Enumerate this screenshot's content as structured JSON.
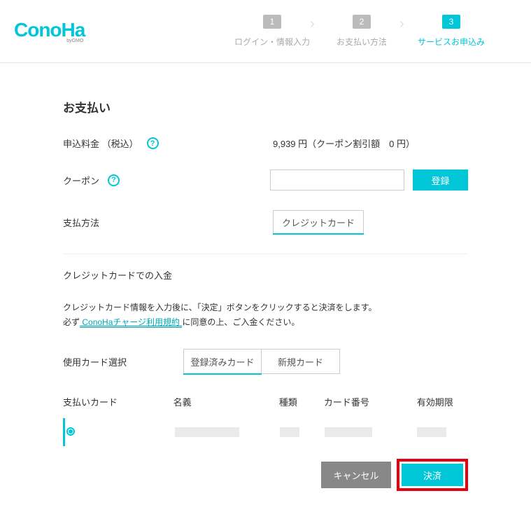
{
  "logo": {
    "main": "ConoHa",
    "sub": "byGMO"
  },
  "wizard": {
    "step1": {
      "num": "1",
      "label": "ログイン・情報入力"
    },
    "step2": {
      "num": "2",
      "label": "お支払い方法"
    },
    "step3": {
      "num": "3",
      "label": "サービスお申込み"
    }
  },
  "page_title": "お支払い",
  "fee": {
    "label": "申込料金 （税込）",
    "text": "9,939 円（クーポン割引額　0 円）"
  },
  "coupon": {
    "label": "クーポン",
    "value": "",
    "placeholder": "",
    "button": "登録"
  },
  "method": {
    "label": "支払方法",
    "credit": "クレジットカード"
  },
  "credit_section": {
    "title": "クレジットカードでの入金",
    "line1": "クレジットカード情報を入力後に、「決定」ボタンをクリックすると決済をします。",
    "line2_pre": "必ず",
    "line2_link": " ConoHaチャージ利用規約 ",
    "line2_post": "に同意の上、ご入金ください。"
  },
  "card_select": {
    "label": "使用カード選択",
    "tab_registered": "登録済みカード",
    "tab_new": "新規カード"
  },
  "table": {
    "paycard_header": "支払いカード",
    "name_header": "名義",
    "type_header": "種類",
    "number_header": "カード番号",
    "exp_header": "有効期限"
  },
  "actions": {
    "cancel": "キャンセル",
    "submit": "決済"
  }
}
